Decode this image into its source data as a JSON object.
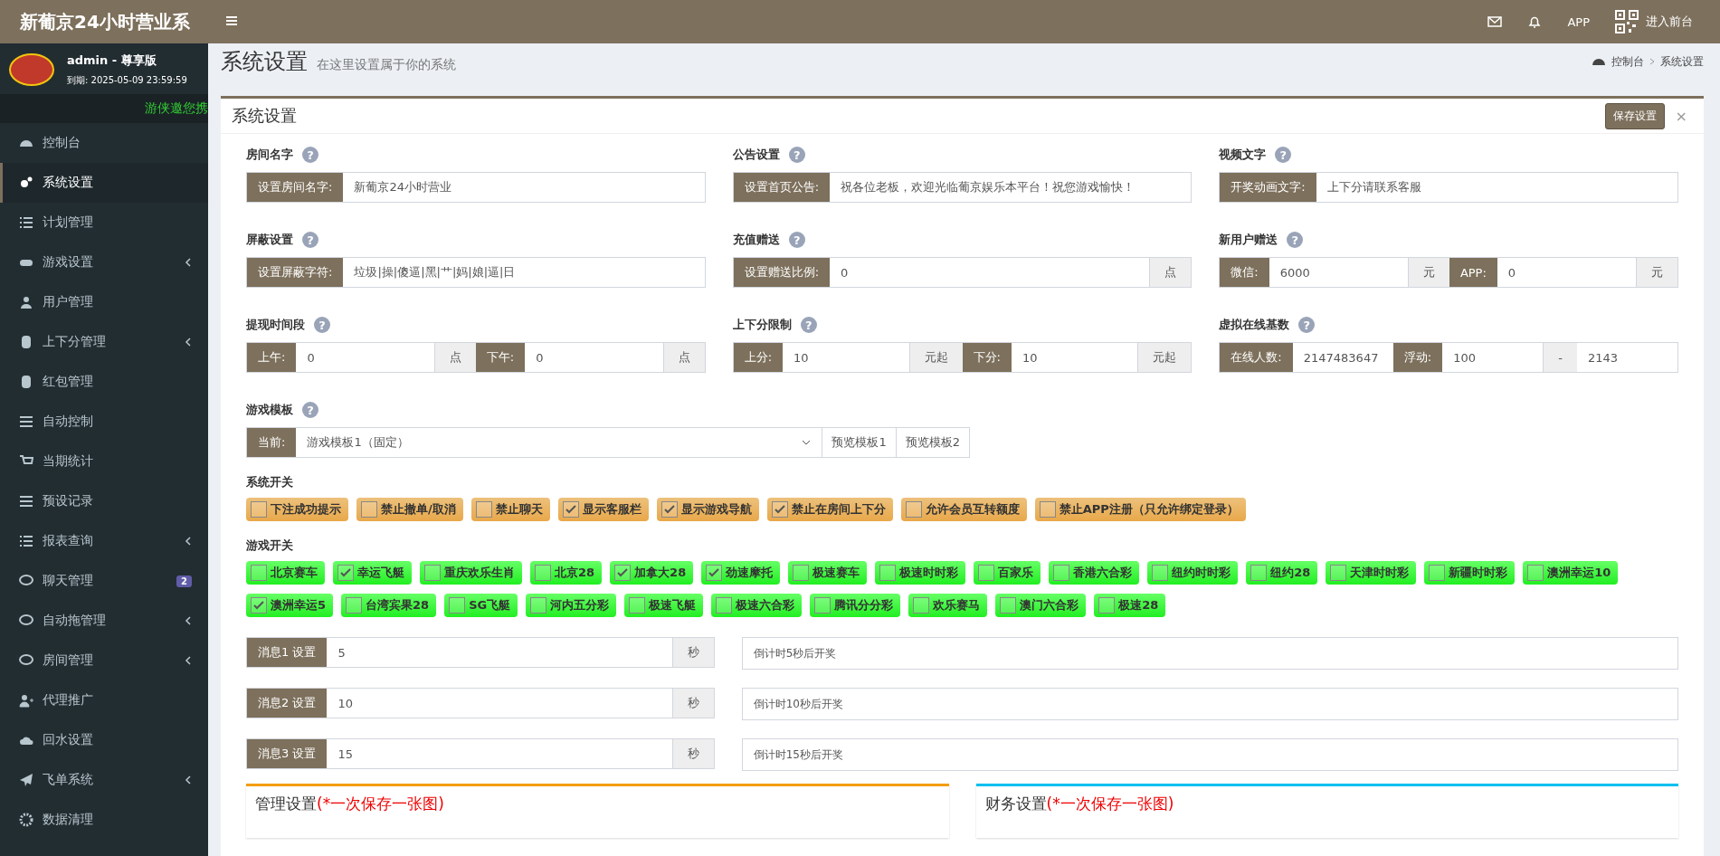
{
  "header": {
    "logo": "新葡京24小时营业系",
    "app_label": "APP",
    "frontend_link": "进入前台"
  },
  "sidebar": {
    "user": {
      "name": "admin - 尊享版",
      "expiry": "到期: 2025-05-09 23:59:59"
    },
    "ticker": "游侠邀您携",
    "items": [
      {
        "label": "控制台",
        "selected": false,
        "has_submenu": false
      },
      {
        "label": "系统设置",
        "selected": true,
        "has_submenu": false
      },
      {
        "label": "计划管理",
        "selected": false,
        "has_submenu": false
      },
      {
        "label": "游戏设置",
        "selected": false,
        "has_submenu": true
      },
      {
        "label": "用户管理",
        "selected": false,
        "has_submenu": false
      },
      {
        "label": "上下分管理",
        "selected": false,
        "has_submenu": true
      },
      {
        "label": "红包管理",
        "selected": false,
        "has_submenu": false
      },
      {
        "label": "自动控制",
        "selected": false,
        "has_submenu": false
      },
      {
        "label": "当期统计",
        "selected": false,
        "has_submenu": false
      },
      {
        "label": "预设记录",
        "selected": false,
        "has_submenu": false
      },
      {
        "label": "报表查询",
        "selected": false,
        "has_submenu": true
      },
      {
        "label": "聊天管理",
        "selected": false,
        "has_submenu": false,
        "badge": "2"
      },
      {
        "label": "自动拖管理",
        "selected": false,
        "has_submenu": true
      },
      {
        "label": "房间管理",
        "selected": false,
        "has_submenu": true
      },
      {
        "label": "代理推广",
        "selected": false,
        "has_submenu": false
      },
      {
        "label": "回水设置",
        "selected": false,
        "has_submenu": false
      },
      {
        "label": "飞单系统",
        "selected": false,
        "has_submenu": true
      },
      {
        "label": "数据清理",
        "selected": false,
        "has_submenu": false
      }
    ]
  },
  "page": {
    "title": "系统设置",
    "subtitle": "在这里设置属于你的系统",
    "breadcrumb": [
      "控制台",
      "系统设置"
    ]
  },
  "panel": {
    "title": "系统设置",
    "save_button": "保存设置",
    "close": "×",
    "groups": [
      {
        "title": "房间名字",
        "help": "?",
        "parts": [
          {
            "kind": "addon",
            "text": "设置房间名字:"
          },
          {
            "kind": "input",
            "text": "新葡京24小时营业"
          }
        ]
      },
      {
        "title": "公告设置",
        "help": "?",
        "parts": [
          {
            "kind": "addon",
            "text": "设置首页公告:"
          },
          {
            "kind": "input",
            "text": "祝各位老板，欢迎光临葡京娱乐本平台！祝您游戏愉快！"
          }
        ]
      },
      {
        "title": "视频文字",
        "help": "?",
        "parts": [
          {
            "kind": "addon",
            "text": "开奖动画文字:"
          },
          {
            "kind": "input",
            "text": "上下分请联系客服"
          }
        ]
      },
      {
        "title": "屏蔽设置",
        "help": "?",
        "parts": [
          {
            "kind": "addon",
            "text": "设置屏蔽字符:"
          },
          {
            "kind": "input",
            "text": "垃圾|操|傻逼|黑|艹|妈|娘|逼|日"
          }
        ]
      },
      {
        "title": "充值赠送",
        "help": "?",
        "parts": [
          {
            "kind": "addon",
            "text": "设置赠送比例:"
          },
          {
            "kind": "input",
            "text": "0"
          },
          {
            "kind": "suffix",
            "text": "点"
          }
        ]
      },
      {
        "title": "新用户赠送",
        "help": "?",
        "parts": [
          {
            "kind": "addon",
            "text": "微信:"
          },
          {
            "kind": "input",
            "text": "6000"
          },
          {
            "kind": "suffix",
            "text": "元"
          },
          {
            "kind": "addon",
            "text": "APP:"
          },
          {
            "kind": "input",
            "text": "0"
          },
          {
            "kind": "suffix",
            "text": "元"
          }
        ]
      },
      {
        "title": "提现时间段",
        "help": "?",
        "parts": [
          {
            "kind": "addon",
            "text": "上午:"
          },
          {
            "kind": "input",
            "text": "0"
          },
          {
            "kind": "suffix",
            "text": "点"
          },
          {
            "kind": "addon",
            "text": "下午:"
          },
          {
            "kind": "input",
            "text": "0"
          },
          {
            "kind": "suffix",
            "text": "点"
          }
        ]
      },
      {
        "title": "上下分限制",
        "help": "?",
        "parts": [
          {
            "kind": "addon",
            "text": "上分:"
          },
          {
            "kind": "input",
            "text": "10"
          },
          {
            "kind": "suffix",
            "text": "元起"
          },
          {
            "kind": "addon",
            "text": "下分:"
          },
          {
            "kind": "input",
            "text": "10"
          },
          {
            "kind": "suffix",
            "text": "元起"
          }
        ]
      },
      {
        "title": "虚拟在线基数",
        "help": "?",
        "parts": [
          {
            "kind": "addon",
            "text": "在线人数:"
          },
          {
            "kind": "input",
            "text": "2147483647"
          },
          {
            "kind": "addon",
            "text": "浮动:"
          },
          {
            "kind": "input",
            "text": "100"
          },
          {
            "kind": "suffix",
            "text": "-"
          },
          {
            "kind": "input",
            "text": "2143"
          }
        ]
      },
      {
        "title": "游戏模板",
        "help": "?",
        "wide": true,
        "parts": [
          {
            "kind": "addon",
            "text": "当前:"
          },
          {
            "kind": "select",
            "text": "游戏模板1（固定）"
          },
          {
            "kind": "button",
            "text": "预览模板1"
          },
          {
            "kind": "button",
            "text": "预览模板2"
          }
        ]
      }
    ],
    "system_switches": {
      "title": "系统开关",
      "items": [
        {
          "label": "下注成功提示",
          "checked": false
        },
        {
          "label": "禁止撤单/取消",
          "checked": false
        },
        {
          "label": "禁止聊天",
          "checked": false
        },
        {
          "label": "显示客服栏",
          "checked": true
        },
        {
          "label": "显示游戏导航",
          "checked": true
        },
        {
          "label": "禁止在房间上下分",
          "checked": true
        },
        {
          "label": "允许会员互转额度",
          "checked": false
        },
        {
          "label": "禁止APP注册（只允许绑定登录）",
          "checked": false
        }
      ]
    },
    "game_switches": {
      "title": "游戏开关",
      "items": [
        {
          "label": "北京赛车",
          "checked": false
        },
        {
          "label": "幸运飞艇",
          "checked": true
        },
        {
          "label": "重庆欢乐生肖",
          "checked": false
        },
        {
          "label": "北京28",
          "checked": false
        },
        {
          "label": "加拿大28",
          "checked": true
        },
        {
          "label": "劲速摩托",
          "checked": true
        },
        {
          "label": "极速赛车",
          "checked": false
        },
        {
          "label": "极速时时彩",
          "checked": false
        },
        {
          "label": "百家乐",
          "checked": false
        },
        {
          "label": "香港六合彩",
          "checked": false
        },
        {
          "label": "纽约时时彩",
          "checked": false
        },
        {
          "label": "纽约28",
          "checked": false
        },
        {
          "label": "天津时时彩",
          "checked": false
        },
        {
          "label": "新疆时时彩",
          "checked": false
        },
        {
          "label": "澳洲幸运10",
          "checked": false
        },
        {
          "label": "澳洲幸运5",
          "checked": true
        },
        {
          "label": "台湾宾果28",
          "checked": false
        },
        {
          "label": "SG飞艇",
          "checked": false
        },
        {
          "label": "河内五分彩",
          "checked": false
        },
        {
          "label": "极速飞艇",
          "checked": false
        },
        {
          "label": "极速六合彩",
          "checked": false
        },
        {
          "label": "腾讯分分彩",
          "checked": false
        },
        {
          "label": "欢乐赛马",
          "checked": false
        },
        {
          "label": "澳门六合彩",
          "checked": false
        },
        {
          "label": "极速28",
          "checked": false
        }
      ]
    },
    "messages": [
      {
        "label": "消息1 设置",
        "value": "5",
        "unit": "秒",
        "text": "倒计时5秒后开奖"
      },
      {
        "label": "消息2 设置",
        "value": "10",
        "unit": "秒",
        "text": "倒计时10秒后开奖"
      },
      {
        "label": "消息3 设置",
        "value": "15",
        "unit": "秒",
        "text": "倒计时15秒后开奖"
      }
    ]
  },
  "sub_panels": [
    {
      "title": "管理设置",
      "note": "(*一次保存一张图)",
      "color": "#f39c12"
    },
    {
      "title": "财务设置",
      "note": "(*一次保存一张图)",
      "color": "#00c0ef"
    }
  ]
}
